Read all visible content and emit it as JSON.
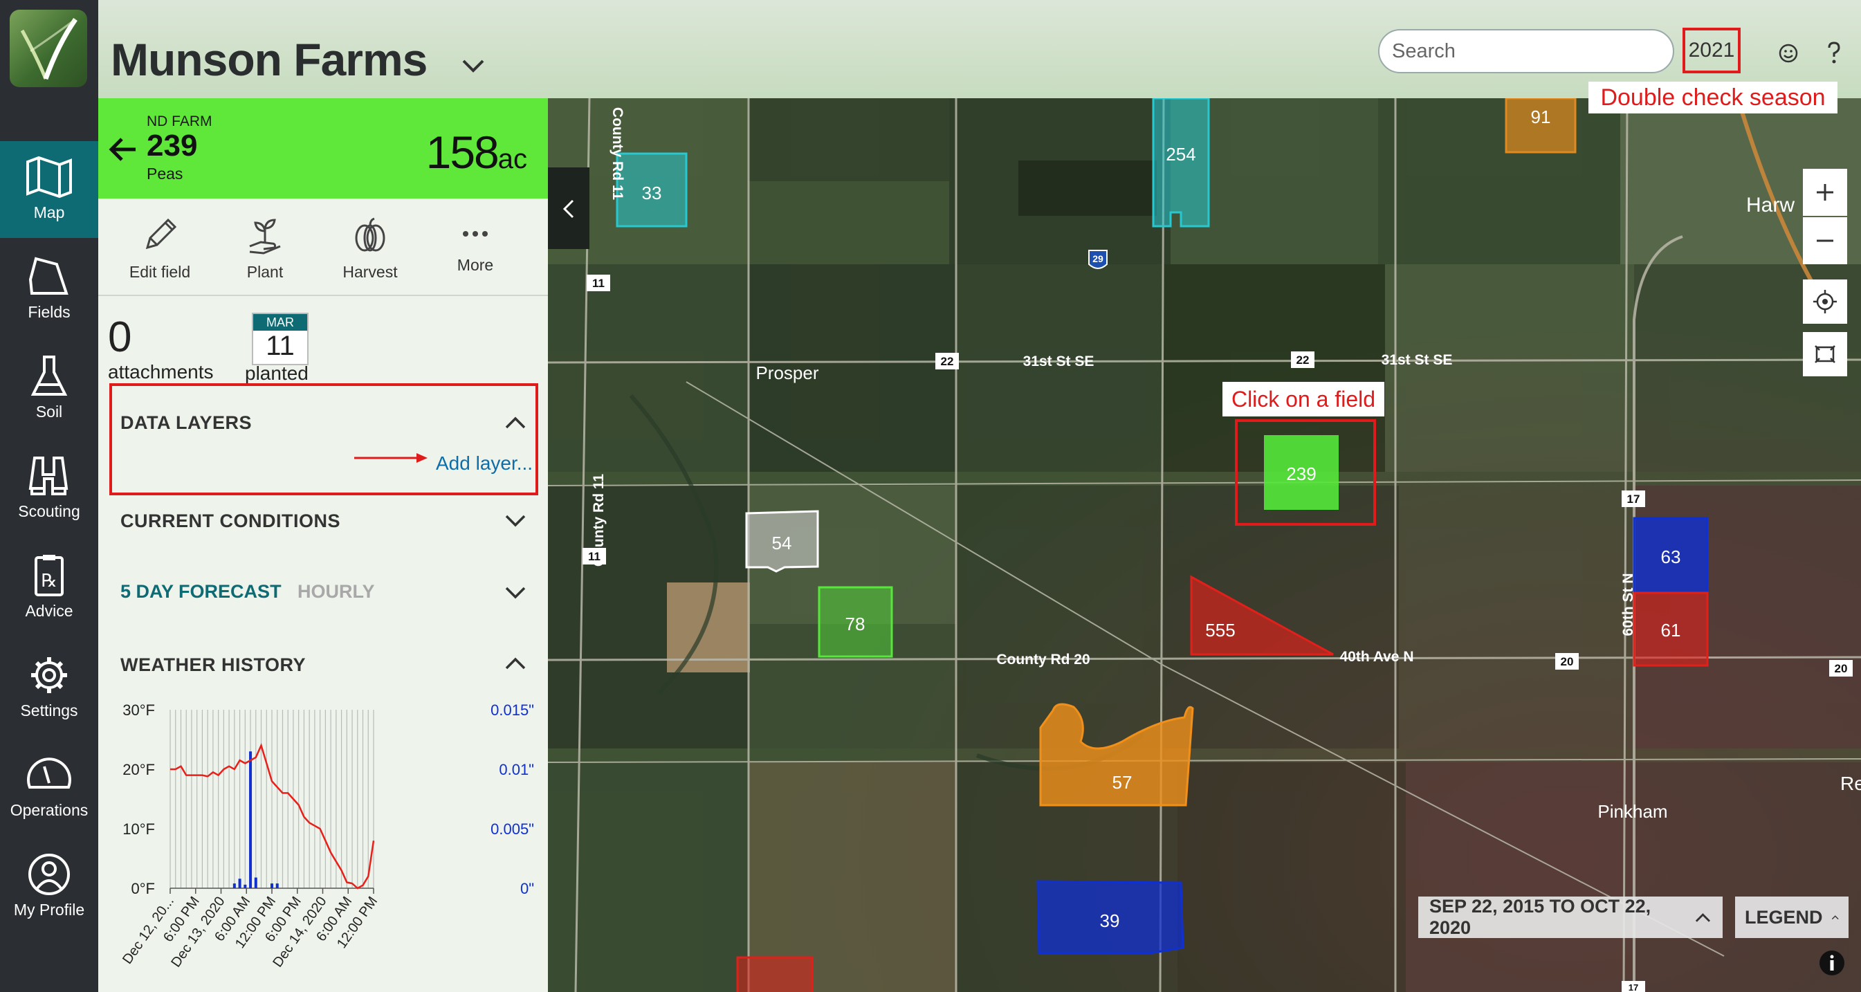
{
  "nav": {
    "items": [
      {
        "label": "Map",
        "icon": "map-icon"
      },
      {
        "label": "Fields",
        "icon": "fields-icon"
      },
      {
        "label": "Soil",
        "icon": "flask-icon"
      },
      {
        "label": "Scouting",
        "icon": "binoculars-icon"
      },
      {
        "label": "Advice",
        "icon": "prescription-icon"
      },
      {
        "label": "Settings",
        "icon": "gear-icon"
      },
      {
        "label": "Operations",
        "icon": "gauge-icon"
      },
      {
        "label": "My Profile",
        "icon": "user-icon"
      }
    ]
  },
  "header": {
    "farm_name": "Munson Farms",
    "search_placeholder": "Search",
    "season": "2021",
    "season_note": "Double check  season"
  },
  "field": {
    "farm_code": "ND FARM",
    "number": "239",
    "crop": "Peas",
    "acres": "158",
    "acres_unit": "ac"
  },
  "actions": [
    {
      "label": "Edit field",
      "icon": "pencil-icon"
    },
    {
      "label": "Plant",
      "icon": "sprout-icon"
    },
    {
      "label": "Harvest",
      "icon": "pumpkin-icon"
    },
    {
      "label": "More",
      "icon": "more-icon"
    }
  ],
  "summary": {
    "attachments_count": "0",
    "attachments_label": "attachments",
    "planted_month": "MAR",
    "planted_day": "11",
    "planted_label": "planted"
  },
  "sections": {
    "data_layers": "DATA LAYERS",
    "add_layer": "Add layer...",
    "current_conditions": "CURRENT CONDITIONS",
    "forecast_tab": "5 DAY FORECAST",
    "hourly_tab": "HOURLY",
    "weather_history": "WEATHER HISTORY"
  },
  "chart_data": {
    "type": "line",
    "title": "",
    "x": [
      "Dec 12, 20...",
      "6:00 PM",
      "Dec 13, 2020",
      "6:00 AM",
      "12:00 PM",
      "6:00 PM",
      "Dec 14, 2020",
      "6:00 AM",
      "12:00 PM"
    ],
    "y_left_ticks": [
      "30°F",
      "20°F",
      "10°F",
      "0°F"
    ],
    "y_right_ticks": [
      "0.015\"",
      "0.01\"",
      "0.005\"",
      "0\""
    ],
    "ylim_left": [
      0,
      30
    ],
    "ylim_right": [
      0,
      0.015
    ],
    "series": [
      {
        "axis": "left",
        "color": "#e8201a",
        "values": [
          20,
          20,
          20.5,
          19,
          19,
          19,
          19,
          18.8,
          19.5,
          19,
          20,
          20.5,
          20,
          21.5,
          21,
          21.5,
          22,
          24,
          21,
          18,
          17,
          16,
          16,
          15,
          14,
          12,
          11,
          10.5,
          10,
          8,
          6,
          4.5,
          3,
          1,
          0.8,
          0,
          0.5,
          2,
          8
        ]
      },
      {
        "axis": "right",
        "color": "#1030d0",
        "type": "bar",
        "values": [
          0,
          0,
          0,
          0,
          0,
          0,
          0,
          0,
          0,
          0,
          0,
          0,
          0.0004,
          0.0008,
          0.0003,
          0.0115,
          0.0009,
          0,
          0,
          0.0004,
          0.0004,
          0,
          0,
          0,
          0,
          0,
          0,
          0,
          0,
          0,
          0,
          0,
          0,
          0,
          0,
          0,
          0,
          0,
          0
        ]
      }
    ]
  },
  "map": {
    "callout": "Click on a field",
    "fields": [
      {
        "id": "33",
        "color": "#28c8d0"
      },
      {
        "id": "254",
        "color": "#28c8d0"
      },
      {
        "id": "91",
        "color": "#e08a20"
      },
      {
        "id": "239",
        "color": "#55e83a"
      },
      {
        "id": "54",
        "color": "#c9c9c9"
      },
      {
        "id": "78",
        "color": "#55e83a"
      },
      {
        "id": "555",
        "color": "#e0201a"
      },
      {
        "id": "63",
        "color": "#1030d0"
      },
      {
        "id": "61",
        "color": "#e0201a"
      },
      {
        "id": "57",
        "color": "#f0901a"
      },
      {
        "id": "39",
        "color": "#1030d0"
      }
    ],
    "labels": {
      "prosper": "Prosper",
      "harwood": "Harw",
      "pinkham": "Pinkham",
      "re": "Re",
      "county_rd_11": "County Rd 11",
      "county_rd_20": "County Rd 20",
      "st31_a": "31st St SE",
      "st31_b": "31st St SE",
      "ave40": "40th Ave N",
      "st60": "60th St N",
      "county_rd_11_top": "County Rd 11"
    },
    "shields": [
      "11",
      "11",
      "22",
      "22",
      "17",
      "20",
      "20",
      "29",
      "17"
    ],
    "date_range": "SEP 22, 2015 TO OCT 22, 2020",
    "legend": "LEGEND"
  }
}
